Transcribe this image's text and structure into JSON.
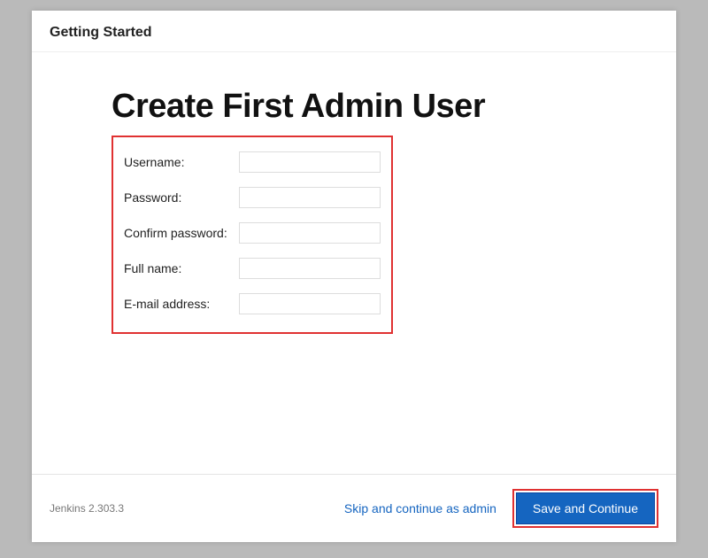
{
  "header": {
    "title": "Getting Started"
  },
  "main": {
    "heading": "Create First Admin User",
    "form": {
      "fields": [
        {
          "label": "Username:",
          "type": "text",
          "value": "",
          "name": "username-field"
        },
        {
          "label": "Password:",
          "type": "password",
          "value": "",
          "name": "password-field"
        },
        {
          "label": "Confirm password:",
          "type": "password",
          "value": "",
          "name": "confirm-password-field"
        },
        {
          "label": "Full name:",
          "type": "text",
          "value": "",
          "name": "fullname-field"
        },
        {
          "label": "E-mail address:",
          "type": "text",
          "value": "",
          "name": "email-field"
        }
      ]
    }
  },
  "footer": {
    "version": "Jenkins 2.303.3",
    "skip_label": "Skip and continue as admin",
    "save_label": "Save and Continue"
  },
  "colors": {
    "highlight_border": "#e03131",
    "primary_button": "#1565c0",
    "link": "#1565c0"
  }
}
